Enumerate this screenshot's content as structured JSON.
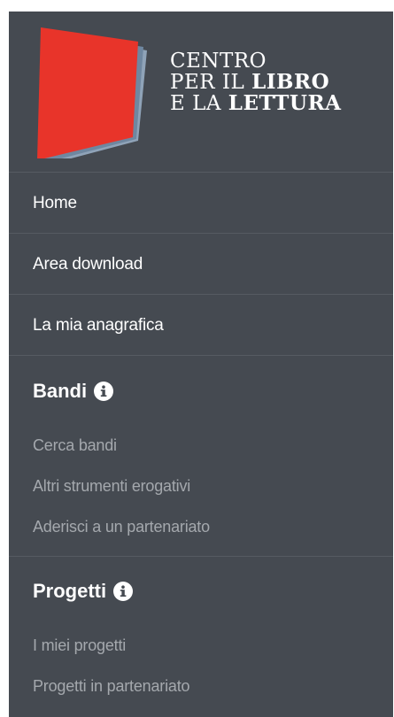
{
  "logo": {
    "line1": "CENTRO",
    "line2_light": "PER IL ",
    "line2_bold": "LIBRO",
    "line3_light": "E LA ",
    "line3_bold": "LETTURA",
    "colors": {
      "red": "#e8342a",
      "slate": "#6f87a0"
    }
  },
  "nav": {
    "home": "Home",
    "area_download": "Area download",
    "anagrafica": "La mia anagrafica"
  },
  "bandi": {
    "title": "Bandi",
    "info_icon": "info-icon",
    "items": [
      "Cerca bandi",
      "Altri strumenti erogativi",
      "Aderisci a un partenariato"
    ]
  },
  "progetti": {
    "title": "Progetti",
    "info_icon": "info-icon",
    "items": [
      "I miei progetti",
      "Progetti in partenariato"
    ]
  },
  "colors": {
    "sidebar_bg": "#454a51",
    "divider": "#565b62",
    "text_primary": "#ffffff",
    "text_secondary": "#a4a8ad"
  }
}
